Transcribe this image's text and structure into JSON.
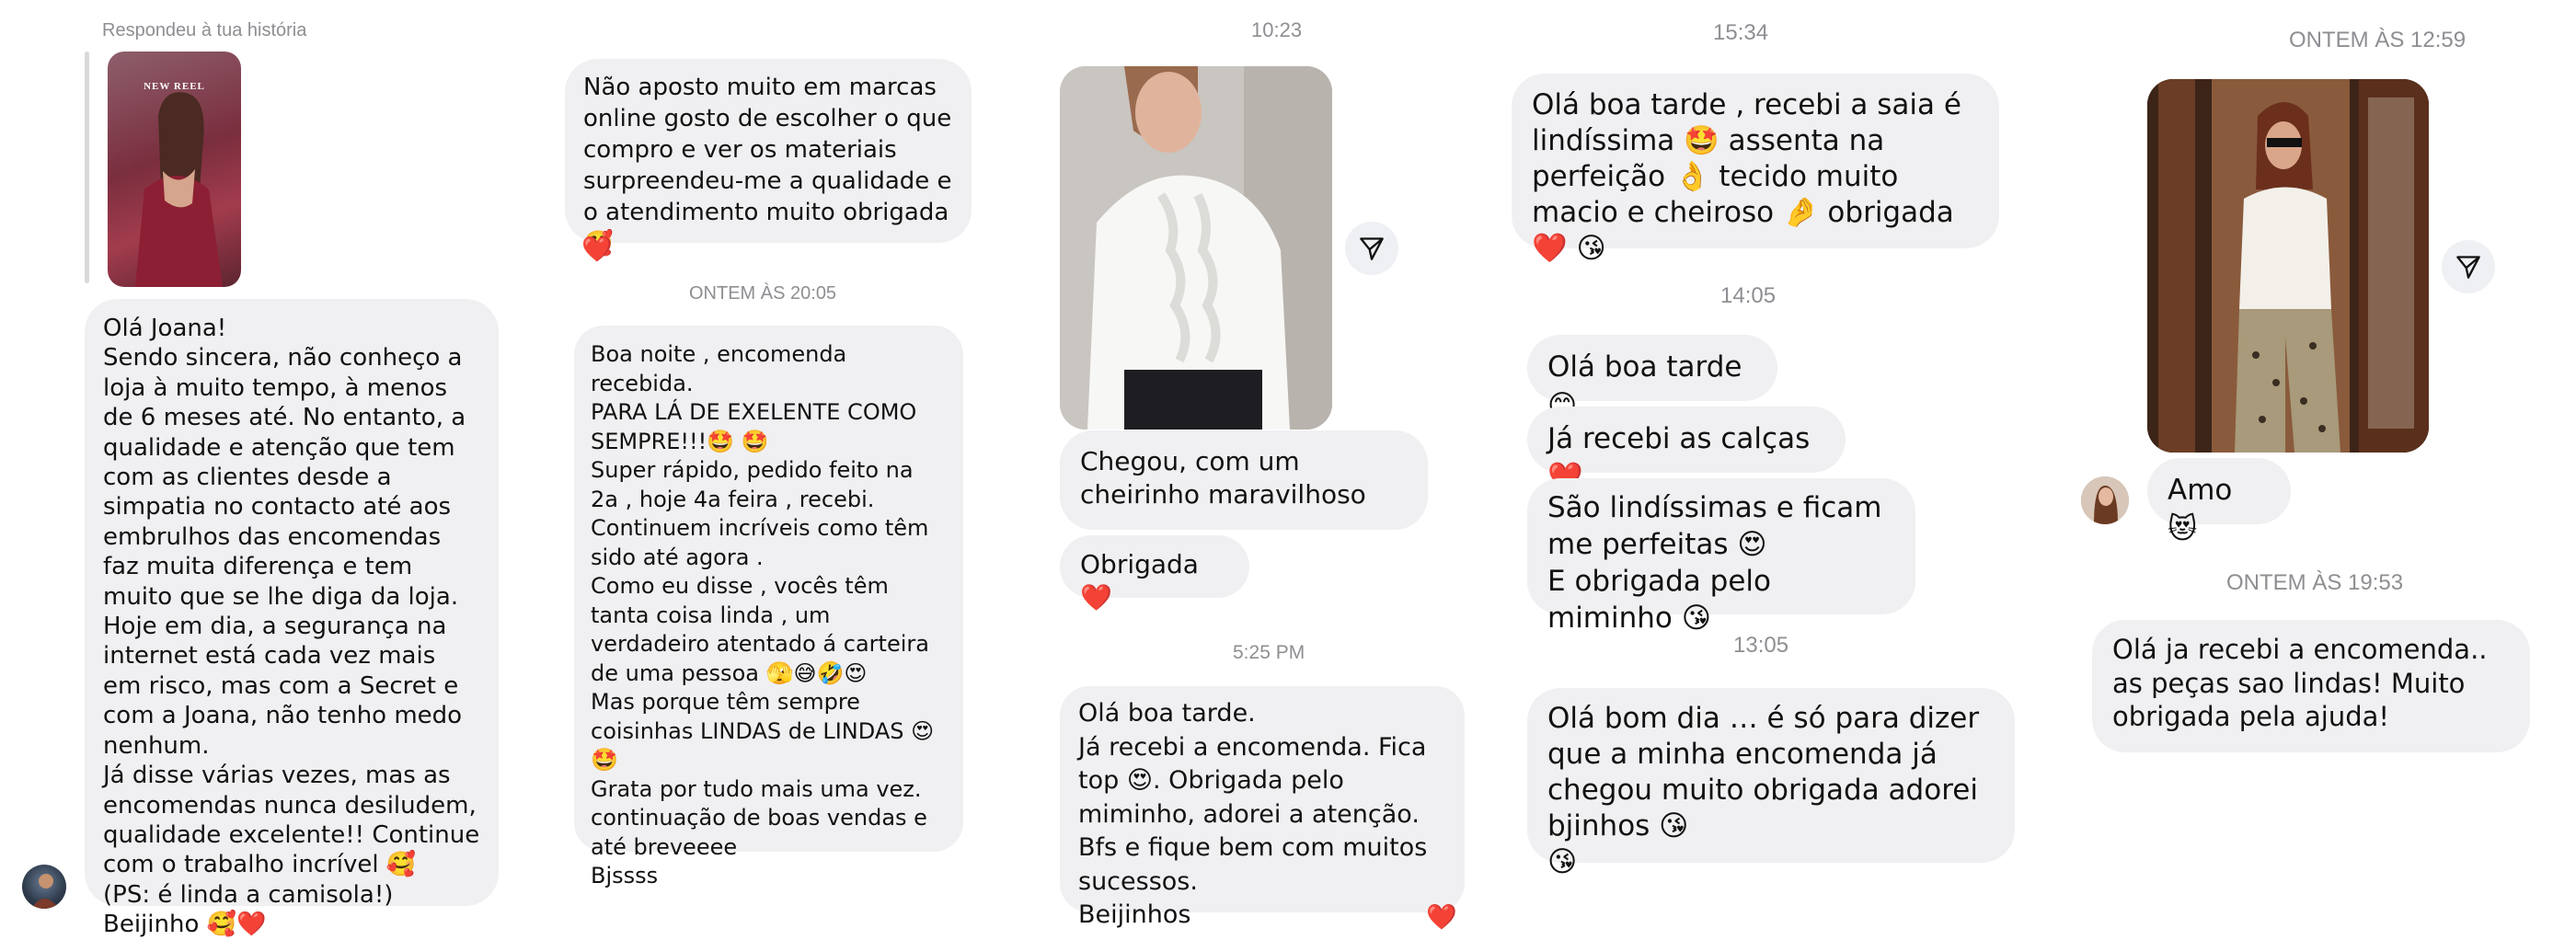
{
  "col1": {
    "story_label": "Respondeu à tua história",
    "story_overlay": "NEW REEL",
    "message": "Olá Joana!\nSendo sincera, não conheço a loja à muito tempo, à menos de 6 meses até. No entanto, a qualidade e atenção que tem com as clientes desde a simpatia no contacto até aos embrulhos das encomendas faz muita diferença e tem muito que se lhe diga da loja.\nHoje em dia, a segurança na internet está cada vez mais em risco, mas com a Secret e com a Joana, não tenho medo nenhum.\nJá disse várias vezes, mas as encomendas nunca desiludem, qualidade excelente!! Continue com o trabalho incrível 🥰\n(PS: é linda a camisola!)\nBeijinho 🥰❤️"
  },
  "col2": {
    "message1": "Não aposto muito em marcas online gosto de escolher o que compro e ver os materiais surpreendeu-me a qualidade e o atendimento muito obrigada 🥰",
    "reaction1": "❤️",
    "timestamp": "ONTEM ÀS 20:05",
    "message2": "Boa noite , encomenda recebida.\nPARA LÁ DE EXELENTE COMO SEMPRE!!!🤩 🤩\nSuper rápido, pedido feito na 2a , hoje 4a feira , recebi.\nContinuem incríveis como têm sido até agora .\nComo eu disse , vocês têm tanta coisa linda , um verdadeiro atentado á carteira de uma pessoa 🫣😅🤣😍\nMas porque têm sempre coisinhas LINDAS de LINDAS 😍🤩\nGrata por tudo mais uma vez.\ncontinuação de boas vendas e até breveeee\nBjssss"
  },
  "col3": {
    "timestamp1": "10:23",
    "message1": "Chegou, com um cheirinho maravilhoso",
    "message2": "Obrigada❤️",
    "timestamp2": "5:25 PM",
    "message3": "Olá boa tarde.\nJá recebi a encomenda. Fica top 😍. Obrigada pelo miminho, adorei a atenção.  Bfs e fique bem com muitos sucessos.\nBeijinhos",
    "reaction": "❤️"
  },
  "col4": {
    "timestamp1": "15:34",
    "message1": "Olá boa tarde , recebi a saia é lindíssima 🤩 assenta na perfeição 👌 tecido muito macio e cheiroso 🤌 obrigada ❤️ 😘",
    "timestamp2": "14:05",
    "message2": "Olá boa tarde 😊",
    "message3": "Já recebi as calças ❤️",
    "message4": "São lindíssimas e ficam me perfeitas 😍\nE obrigada pelo miminho 😘",
    "timestamp3": "13:05",
    "message5": "Olá bom dia … é só para dizer que a minha encomenda já chegou muito obrigada adorei bjinhos 😘\n😘"
  },
  "col5": {
    "timestamp1": "ONTEM ÀS 12:59",
    "message1": "Amo 😻",
    "timestamp2": "ONTEM ÀS 19:53",
    "message2": "Olá ja recebi a encomenda.. as peças sao lindas! Muito obrigada pela ajuda!"
  },
  "icons": {
    "send": "paper-plane-icon",
    "reaction": "heart-icon"
  },
  "colors": {
    "bubble": "#f0f0f2",
    "timestamp": "#8e8e93",
    "heart": "#e8243a"
  }
}
